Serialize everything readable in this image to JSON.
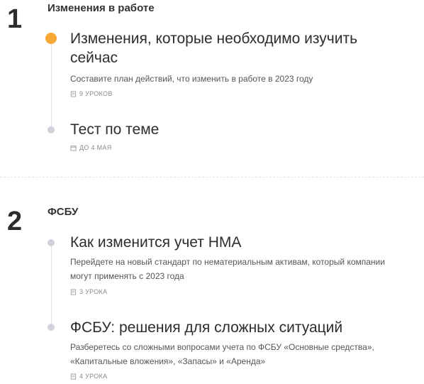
{
  "sections": [
    {
      "number": "1",
      "title": "Изменения в работе",
      "lessons": [
        {
          "title_line1": "Изменения, которые необходимо изучить",
          "title_line2": "сейчас",
          "description": "Составите план действий, что изменить в работе в 2023 году",
          "meta": "9 УРОКОВ",
          "meta_icon": "book-icon",
          "status": "active",
          "status_color": "#f7a935"
        },
        {
          "title_line1": "Тест по теме",
          "meta": "ДО 4 МАЯ",
          "meta_icon": "calendar-icon",
          "status": "pending"
        }
      ]
    },
    {
      "number": "2",
      "title": "ФСБУ",
      "lessons": [
        {
          "title_line1": "Как изменится учет НМА",
          "description_line1": "Перейдете на новый стандарт по нематериальным активам, который компании",
          "description_line2": "могут применять с 2023 года",
          "meta": "3 УРОКА",
          "meta_icon": "book-icon",
          "status": "pending"
        },
        {
          "title_line1": "ФСБУ: решения для сложных ситуаций",
          "description_line1": "Разберетесь со сложными вопросами учета по ФСБУ «Основные средства»,",
          "description_line2": "«Капитальные вложения», «Запасы» и «Аренда»",
          "meta": "4 УРОКА",
          "meta_icon": "book-icon",
          "status": "pending"
        }
      ]
    }
  ],
  "colors": {
    "active_dot": "#f7a935",
    "pending_dot": "#cfd2da",
    "timeline": "#e2e2e2"
  }
}
